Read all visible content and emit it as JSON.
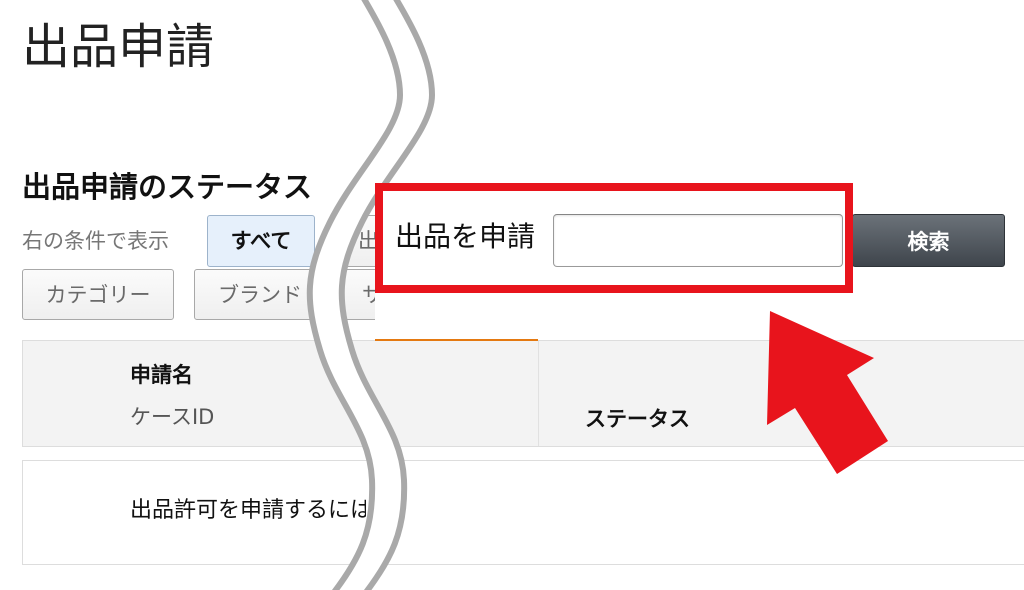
{
  "page_title": "出品申請",
  "status_section": {
    "heading": "出品申請のステータス",
    "filter_label": "右の条件で表示",
    "filters_row1": [
      {
        "label": "すべて",
        "selected": true
      },
      {
        "label": "出",
        "selected": false
      }
    ],
    "filters_row2": [
      {
        "label": "カテゴリー",
        "selected": false
      },
      {
        "label": "ブランド",
        "selected": false
      },
      {
        "label": "サ",
        "selected": false
      }
    ]
  },
  "table": {
    "header": {
      "name_column": "申請名",
      "case_id_column": "ケースID",
      "status_column": "ステータス"
    },
    "rows": [
      {
        "name": "出品許可を申請するには"
      }
    ]
  },
  "apply_callout": {
    "label": "出品を申請",
    "input_value": "",
    "search_button": "検索"
  },
  "colors": {
    "highlight_red": "#e8141c",
    "active_column_orange": "#e47911",
    "selected_filter_bg": "#e6f0fb",
    "search_button_top": "#6b7279",
    "search_button_bottom": "#3f454c"
  }
}
